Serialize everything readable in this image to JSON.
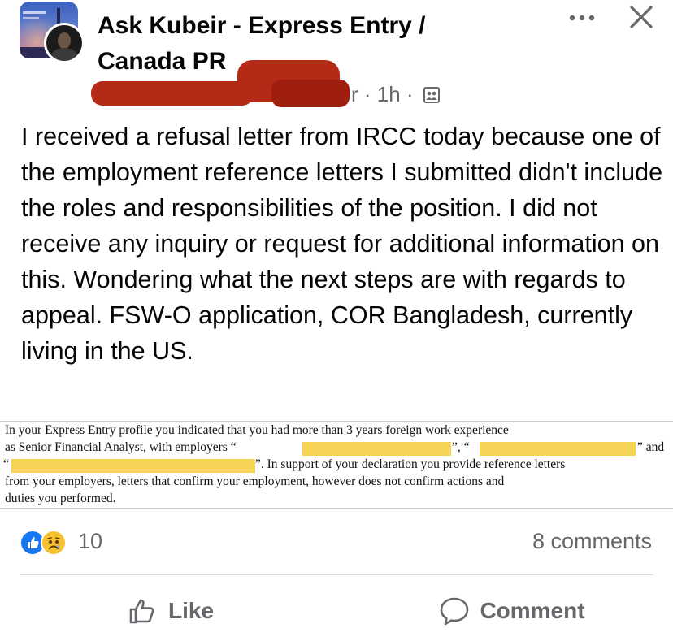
{
  "header": {
    "group_name": "Ask Kubeir - Express Entry / Canada PR",
    "group_avatar_icon": "group-cover-icon",
    "user_avatar_icon": "user-avatar-icon",
    "more_icon": "ellipsis-icon",
    "close_icon": "close-icon"
  },
  "meta": {
    "author_text": "r",
    "time": "· 1h ·",
    "audience_icon": "group-audience-icon",
    "redaction_color": "#b52a16"
  },
  "post": {
    "text": "I received a refusal letter from IRCC today because one of the employment reference letters I submitted didn't include the roles and responsibilities of the position. I did not receive any inquiry or request for additional information on this. Wondering what the next steps are with regards to appeal. FSW-O application, COR Bangladesh, currently living in the US."
  },
  "excerpt": {
    "line1": "In your Express Entry profile you indicated that you had more than 3 years foreign work experience",
    "line2_a": "as Senior Financial Analyst, with employers “",
    "line2_b": "”, “",
    "line2_c": "” and",
    "line3_a": "“",
    "line3_b": "”. In support of your declaration you provide reference letters",
    "line4": "from your employers, letters that confirm your employment, however does not confirm actions and",
    "line5": "duties you performed.",
    "highlight_color": "#f5d357"
  },
  "reactions": {
    "count": "10",
    "icons": [
      "like-reaction-icon",
      "sad-reaction-icon"
    ],
    "comments": "8 comments"
  },
  "actions": {
    "like_label": "Like",
    "comment_label": "Comment",
    "like_icon": "thumbs-up-icon",
    "comment_icon": "speech-bubble-icon"
  },
  "colors": {
    "facebook_blue": "#1877f2",
    "secondary_text": "#65676b",
    "primary_text": "#050505"
  }
}
